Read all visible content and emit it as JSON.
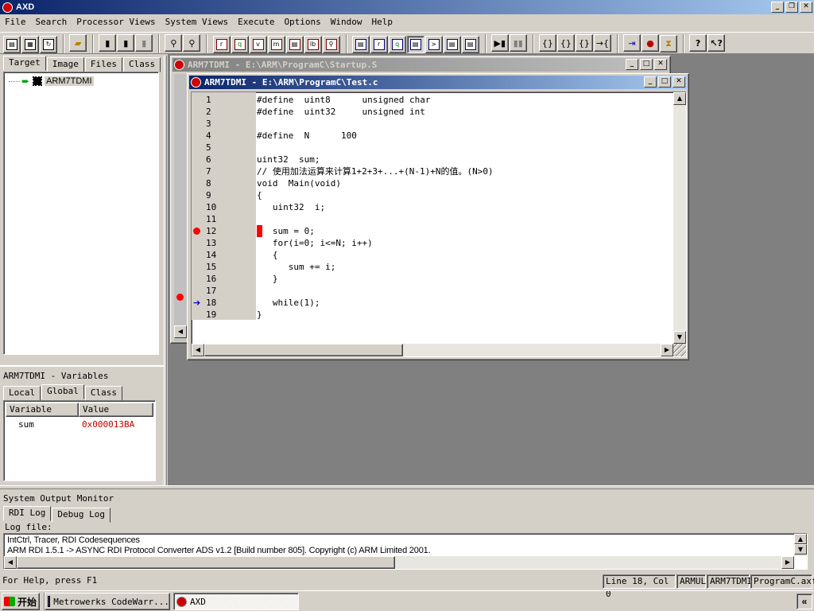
{
  "app": {
    "title": "AXD"
  },
  "menu": [
    "File",
    "Search",
    "Processor Views",
    "System Views",
    "Execute",
    "Options",
    "Window",
    "Help"
  ],
  "toolbar_icons": [
    "open-file-icon",
    "save-icon",
    "reload-icon",
    "open-folder-icon",
    "cut-icon",
    "copy-icon",
    "paste-icon",
    "find-icon",
    "find-next-icon",
    "registers-icon",
    "watch-icon",
    "variables-icon",
    "memory-icon",
    "backtrace-icon",
    "low-level-icon",
    "source-icon",
    "console-icon",
    "disassembly-icon",
    "breakpoint-list-icon",
    "watchpoint-list-icon",
    "go-icon",
    "stop-icon",
    "step-icon",
    "step-in-icon",
    "step-out-icon",
    "run-to-cursor-icon",
    "toggle-breakpoint-icon",
    "toggle-watchpoint-icon",
    "hourglass-icon",
    "help-icon",
    "context-help-icon"
  ],
  "left_panel": {
    "tabs": [
      "Target",
      "Image",
      "Files",
      "Class"
    ],
    "tree_item": "ARM7TDMI"
  },
  "variables_panel": {
    "title": "ARM7TDMI - Variables",
    "tabs": [
      "Local",
      "Global",
      "Class"
    ],
    "headers": [
      "Variable",
      "Value"
    ],
    "rows": [
      {
        "name": "sum",
        "value": "0x000013BA"
      }
    ],
    "value_color": "#c00000"
  },
  "startup_window": {
    "title": "ARM7TDMI - E:\\ARM\\ProgramC\\Startup.S"
  },
  "code_window": {
    "title": "ARM7TDMI - E:\\ARM\\ProgramC\\Test.c",
    "lines": [
      {
        "n": "1",
        "code": "#define  uint8      unsigned char"
      },
      {
        "n": "2",
        "code": "#define  uint32     unsigned int"
      },
      {
        "n": "3",
        "code": ""
      },
      {
        "n": "4",
        "code": "#define  N      100"
      },
      {
        "n": "5",
        "code": ""
      },
      {
        "n": "6",
        "code": "uint32  sum;"
      },
      {
        "n": "7",
        "code": "// 使用加法运算来计算1+2+3+...+(N-1)+N的值。(N>0)"
      },
      {
        "n": "8",
        "code": "void  Main(void)"
      },
      {
        "n": "9",
        "code": "{"
      },
      {
        "n": "10",
        "code": "   uint32  i;"
      },
      {
        "n": "11",
        "code": ""
      },
      {
        "n": "12",
        "code": "   sum = 0;"
      },
      {
        "n": "13",
        "code": "   for(i=0; i<=N; i++)"
      },
      {
        "n": "14",
        "code": "   {"
      },
      {
        "n": "15",
        "code": "      sum += i;"
      },
      {
        "n": "16",
        "code": "   }"
      },
      {
        "n": "17",
        "code": ""
      },
      {
        "n": "18",
        "code": "   while(1);"
      },
      {
        "n": "19",
        "code": "}"
      }
    ],
    "breakpoint_line": "12",
    "current_line": "18",
    "breakpoint_color": "#ff0000",
    "pc_arrow_color": "#0000c0"
  },
  "output": {
    "title": "System Output Monitor",
    "tabs": [
      "RDI Log",
      "Debug Log"
    ],
    "log_label": "Log file:",
    "lines": [
      "IntCtrl, Tracer, RDI Codesequences",
      "ARM RDI 1.5.1 -> ASYNC RDI Protocol Converter ADS v1.2 [Build number 805]. Copyright (c) ARM Limited 2001."
    ]
  },
  "status": {
    "help": "For Help, press F1",
    "position": "Line 18, Col 0",
    "mode": "ARMUL",
    "processor": "ARM7TDMI",
    "image": "ProgramC.axf"
  },
  "taskbar": {
    "start": "开始",
    "tasks": [
      "Metrowerks CodeWarr...",
      "AXD"
    ]
  }
}
